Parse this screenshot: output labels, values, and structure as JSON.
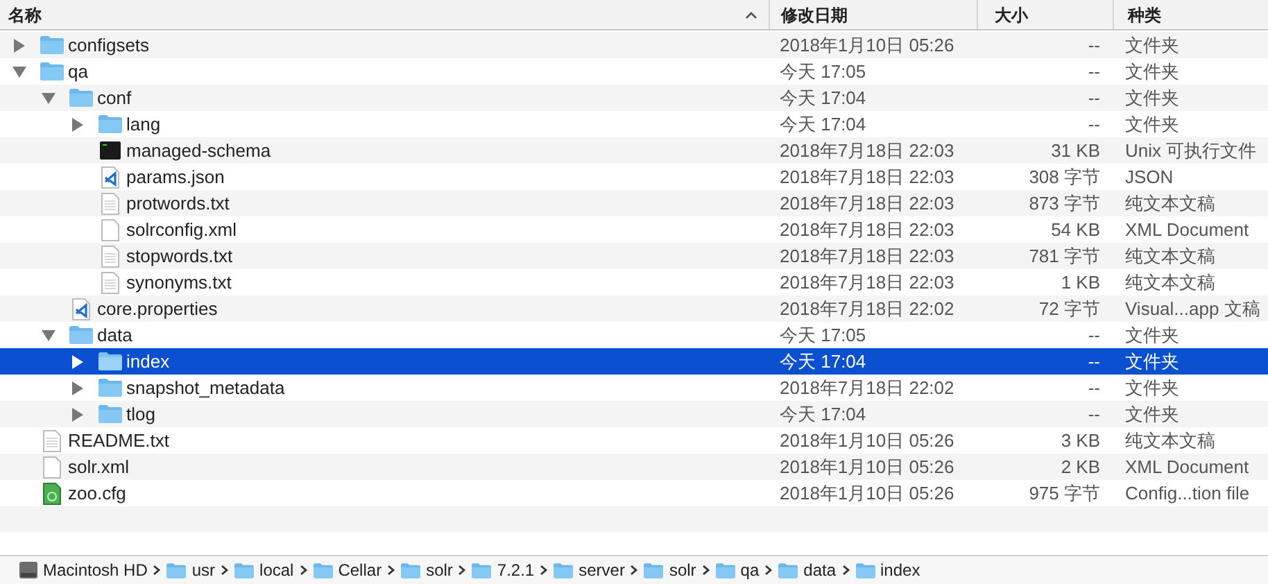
{
  "columns": [
    {
      "label": "名称",
      "sorted": true
    },
    {
      "label": "修改日期",
      "sorted": false
    },
    {
      "label": "大小",
      "sorted": false
    },
    {
      "label": "种类",
      "sorted": false
    }
  ],
  "rows": [
    {
      "name": "configsets",
      "kind": "folder",
      "expanded": false,
      "selected": false,
      "date": "2018年1月10日 05:26",
      "size": "--",
      "file_type": "文件夹"
    },
    {
      "name": "qa",
      "kind": "folder",
      "expanded": true,
      "selected": false,
      "date": "今天 17:05",
      "size": "--",
      "file_type": "文件夹",
      "children": [
        {
          "name": "conf",
          "kind": "folder",
          "expanded": true,
          "selected": false,
          "date": "今天 17:04",
          "size": "--",
          "file_type": "文件夹",
          "children": [
            {
              "name": "lang",
              "kind": "folder",
              "expanded": false,
              "selected": false,
              "date": "今天 17:04",
              "size": "--",
              "file_type": "文件夹"
            },
            {
              "name": "managed-schema",
              "kind": "terminal",
              "selected": false,
              "date": "2018年7月18日 22:03",
              "size": "31 KB",
              "file_type": "Unix 可执行文件"
            },
            {
              "name": "params.json",
              "kind": "code",
              "selected": false,
              "date": "2018年7月18日 22:03",
              "size": "308 字节",
              "file_type": "JSON"
            },
            {
              "name": "protwords.txt",
              "kind": "text",
              "selected": false,
              "date": "2018年7月18日 22:03",
              "size": "873 字节",
              "file_type": "纯文本文稿"
            },
            {
              "name": "solrconfig.xml",
              "kind": "blank",
              "selected": false,
              "date": "2018年7月18日 22:03",
              "size": "54 KB",
              "file_type": "XML Document"
            },
            {
              "name": "stopwords.txt",
              "kind": "text",
              "selected": false,
              "date": "2018年7月18日 22:03",
              "size": "781 字节",
              "file_type": "纯文本文稿"
            },
            {
              "name": "synonyms.txt",
              "kind": "text",
              "selected": false,
              "date": "2018年7月18日 22:03",
              "size": "1 KB",
              "file_type": "纯文本文稿"
            }
          ]
        },
        {
          "name": "core.properties",
          "kind": "code",
          "selected": false,
          "date": "2018年7月18日 22:02",
          "size": "72 字节",
          "file_type": "Visual...app 文稿"
        },
        {
          "name": "data",
          "kind": "folder",
          "expanded": true,
          "selected": false,
          "date": "今天 17:05",
          "size": "--",
          "file_type": "文件夹",
          "children": [
            {
              "name": "index",
              "kind": "folder",
              "expanded": false,
              "selected": true,
              "date": "今天 17:04",
              "size": "--",
              "file_type": "文件夹"
            },
            {
              "name": "snapshot_metadata",
              "kind": "folder",
              "expanded": false,
              "selected": false,
              "date": "2018年7月18日 22:02",
              "size": "--",
              "file_type": "文件夹"
            },
            {
              "name": "tlog",
              "kind": "folder",
              "expanded": false,
              "selected": false,
              "date": "今天 17:04",
              "size": "--",
              "file_type": "文件夹"
            }
          ]
        }
      ]
    },
    {
      "name": "README.txt",
      "kind": "text",
      "selected": false,
      "date": "2018年1月10日 05:26",
      "size": "3 KB",
      "file_type": "纯文本文稿"
    },
    {
      "name": "solr.xml",
      "kind": "blank",
      "selected": false,
      "date": "2018年1月10日 05:26",
      "size": "2 KB",
      "file_type": "XML Document"
    },
    {
      "name": "zoo.cfg",
      "kind": "config",
      "selected": false,
      "date": "2018年1月10日 05:26",
      "size": "975 字节",
      "file_type": "Config...tion file"
    }
  ],
  "path_bar": [
    {
      "label": "Macintosh HD",
      "kind": "disk"
    },
    {
      "label": "usr",
      "kind": "folder"
    },
    {
      "label": "local",
      "kind": "folder"
    },
    {
      "label": "Cellar",
      "kind": "folder"
    },
    {
      "label": "solr",
      "kind": "folder"
    },
    {
      "label": "7.2.1",
      "kind": "folder"
    },
    {
      "label": "server",
      "kind": "folder"
    },
    {
      "label": "solr",
      "kind": "folder"
    },
    {
      "label": "qa",
      "kind": "folder"
    },
    {
      "label": "data",
      "kind": "folder"
    },
    {
      "label": "index",
      "kind": "folder"
    }
  ]
}
